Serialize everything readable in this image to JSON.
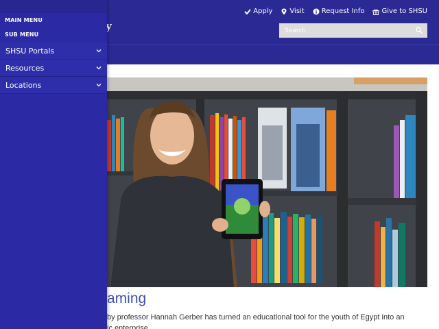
{
  "header": {
    "brand_fragment": "y",
    "utility_links": [
      {
        "label": "Apply",
        "icon": "check-icon"
      },
      {
        "label": "Visit",
        "icon": "map-pin-icon"
      },
      {
        "label": "Request Info",
        "icon": "info-icon"
      },
      {
        "label": "Give to SHSU",
        "icon": "gift-icon"
      }
    ],
    "search": {
      "placeholder": "Search",
      "icon": "search-icon"
    }
  },
  "drawer": {
    "main_menu_label": "MAIN MENU",
    "sub_menu_label": "SUB MENU",
    "items": [
      {
        "label": "SHSU Portals",
        "icon": "chevron-down-icon"
      },
      {
        "label": "Resources",
        "icon": "chevron-down-icon"
      },
      {
        "label": "Locations",
        "icon": "chevron-down-icon"
      }
    ]
  },
  "article": {
    "title_fragment": "aming",
    "text_line1": "by professor Hannah Gerber has turned an educational tool for the youth of Egypt into an",
    "text_line2": "ic  enterprise"
  },
  "colors": {
    "header_bg": "#2b2a95",
    "drawer_bg": "#2b2aa4",
    "title_color": "#3f4fb8"
  }
}
